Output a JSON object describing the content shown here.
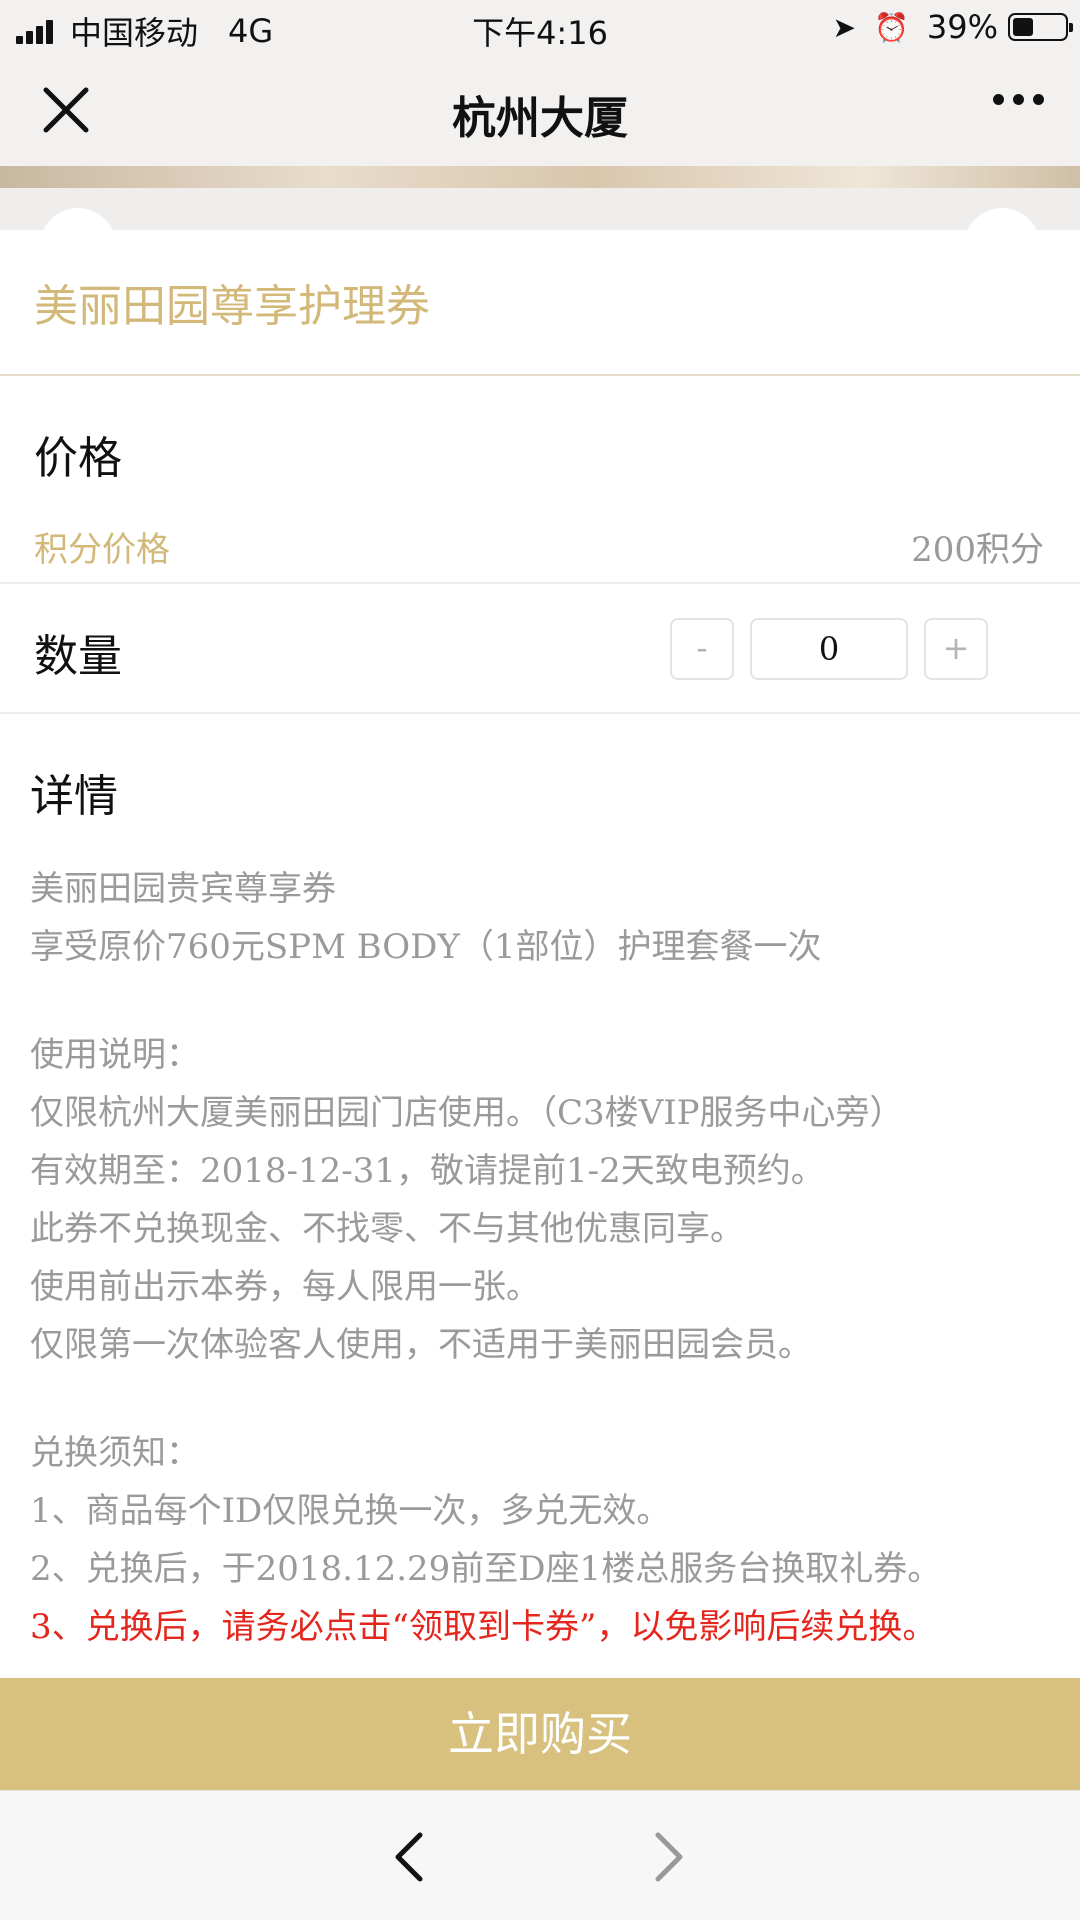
{
  "status_bar": {
    "carrier": "中国移动",
    "network": "4G",
    "time": "下午4:16",
    "battery_percent": "39%",
    "battery_level": 0.39
  },
  "nav": {
    "title": "杭州大厦"
  },
  "product": {
    "title": "美丽田园尊享护理券"
  },
  "price": {
    "heading": "价格",
    "label": "积分价格",
    "value": "200积分"
  },
  "quantity": {
    "heading": "数量",
    "minus": "-",
    "value": "0",
    "plus": "+"
  },
  "details": {
    "heading": "详情",
    "line1": "美丽田园贵宾尊享券",
    "line2": "享受原价760元SPM BODY（1部位）护理套餐一次",
    "usage_title": "使用说明：",
    "usage1": "仅限杭州大厦美丽田园门店使用。（C3楼VIP服务中心旁）",
    "usage2": "有效期至：2018-12-31，敬请提前1-2天致电预约。",
    "usage3": "此券不兑换现金、不找零、不与其他优惠同享。",
    "usage4": "使用前出示本券，每人限用一张。",
    "usage5": "仅限第一次体验客人使用，不适用于美丽田园会员。",
    "exchange_title": "兑换须知：",
    "exchange1": "1、商品每个ID仅限兑换一次，多兑无效。",
    "exchange2": "2、兑换后，于2018.12.29前至D座1楼总服务台换取礼券。",
    "exchange3": "3、兑换后，请务必点击“领取到卡券”，以免影响后续兑换。"
  },
  "buy_button": {
    "label": "立即购买"
  },
  "colors": {
    "gold": "#d3b979",
    "buy_bg": "#d8c17e",
    "warning_red": "#e4261d"
  }
}
